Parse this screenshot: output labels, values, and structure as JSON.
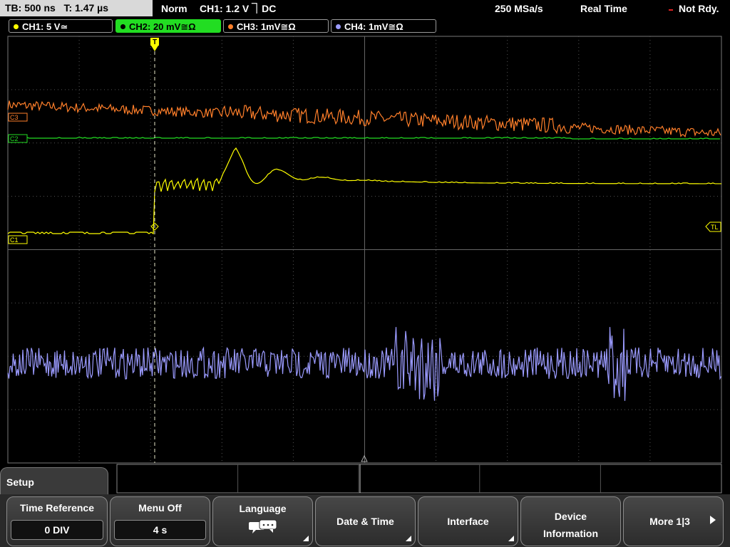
{
  "topbar": {
    "timebase": "TB: 500 ns   T: 1.47 µs",
    "mode": "Norm",
    "trigger": "CH1: 1.2 V ⏋DC",
    "sample_rate": "250 MSa/s",
    "acq_mode": "Real Time",
    "status": "Not Rdy."
  },
  "channels": [
    {
      "label": "CH1: 5 V≃",
      "color": "#ffff00",
      "active": false
    },
    {
      "label": "CH2: 20 mV≅Ω",
      "color": "#22dd22",
      "active": true
    },
    {
      "label": "CH3: 1mV≅Ω",
      "color": "#ff7f2a",
      "active": false
    },
    {
      "label": "CH4: 1mV≅Ω",
      "color": "#9b9bff",
      "active": false
    }
  ],
  "markers": {
    "c3": "C3",
    "c2": "C2",
    "c1": "C1",
    "trigger_level": "TL",
    "trigger_pos": "T"
  },
  "colors": {
    "ch1": "#ffff00",
    "ch2": "#22dd22",
    "ch3": "#ff7f2a",
    "ch4": "#9b9bff",
    "grid": "#555555",
    "cursor": "#e6e6c8"
  },
  "menu": {
    "title": "Setup",
    "buttons": [
      {
        "label": "Time Reference",
        "value": "0 DIV"
      },
      {
        "label": "Menu Off",
        "value": "4 s"
      },
      {
        "label": "Language",
        "value": ""
      },
      {
        "label": "Date & Time",
        "value": ""
      },
      {
        "label": "Interface",
        "value": ""
      },
      {
        "label": "Device Information",
        "value": ""
      },
      {
        "label": "More 1|3",
        "value": ""
      }
    ]
  }
}
